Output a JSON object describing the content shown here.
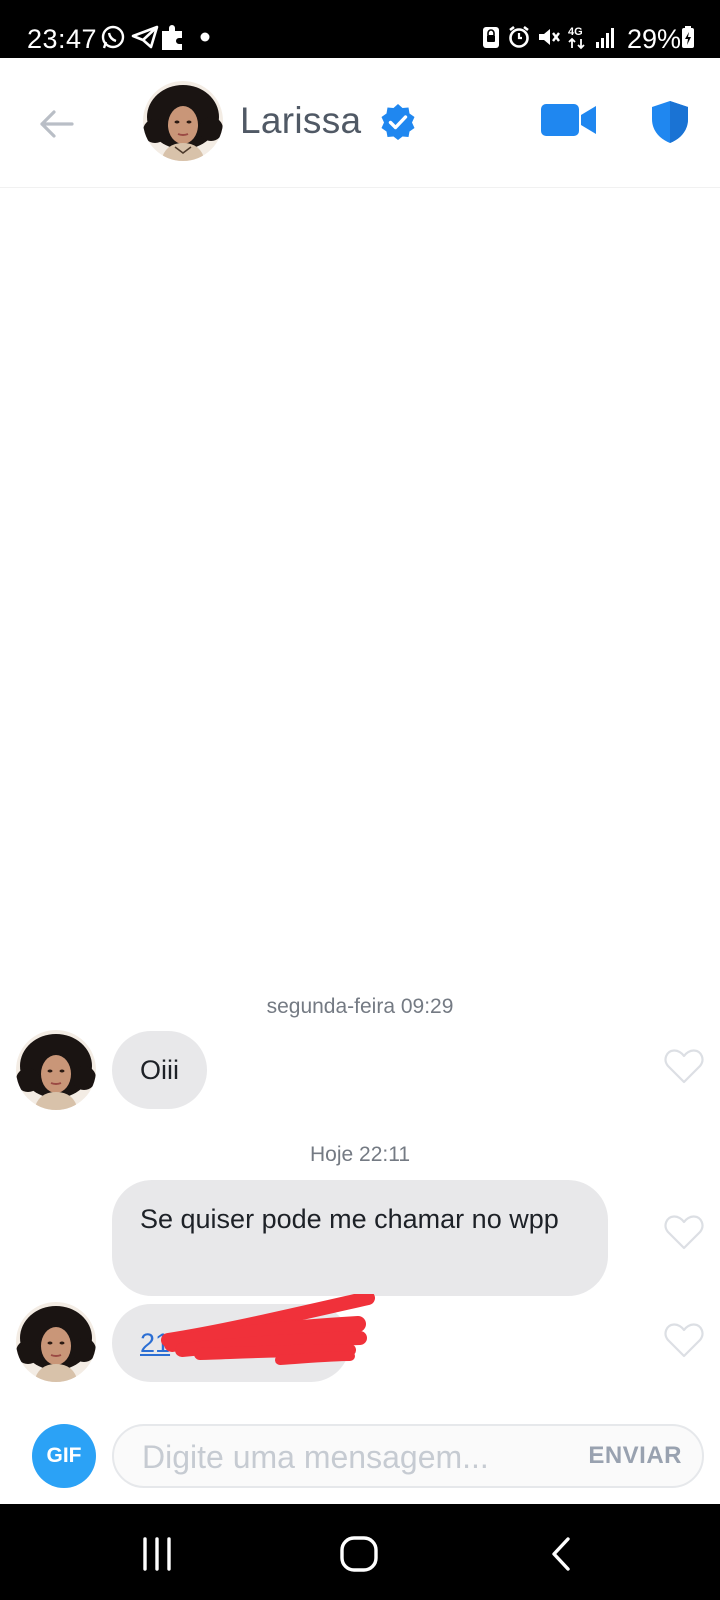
{
  "status_bar": {
    "time": "23:47",
    "battery": "29%",
    "icons": [
      "whatsapp-icon",
      "telegram-icon",
      "puzzle-icon",
      "dot-icon",
      "lock-icon",
      "alarm-icon",
      "mute-icon",
      "4g-icon",
      "signal-icon",
      "battery-icon"
    ]
  },
  "header": {
    "contact_name": "Larissa",
    "verified": true,
    "accent_color": "#1f87f0"
  },
  "messages": [
    {
      "day_label": "segunda-feira 09:29"
    },
    {
      "sender": "them",
      "text": "Oiii",
      "liked": false
    },
    {
      "day_label": "Hoje 22:11"
    },
    {
      "sender": "them",
      "text": "Se quiser pode me chamar no wpp",
      "liked": false
    },
    {
      "sender": "them",
      "text": "21",
      "is_link": true,
      "redacted": true,
      "liked": false
    }
  ],
  "composer": {
    "gif_label": "GIF",
    "placeholder": "Digite uma mensagem...",
    "send_label": "ENVIAR"
  },
  "nav": {
    "icons": [
      "recents-icon",
      "home-icon",
      "back-icon"
    ]
  }
}
